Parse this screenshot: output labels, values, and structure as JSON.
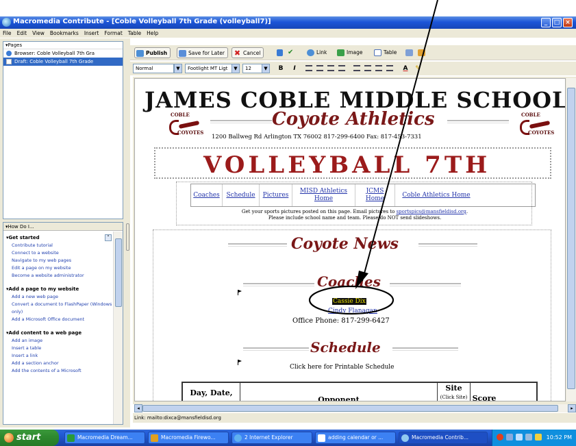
{
  "window": {
    "title": "Macromedia Contribute - [Coble Volleyball 7th Grade (volleyball7)]",
    "buttons": [
      "_",
      "□",
      "×"
    ]
  },
  "menu": [
    "File",
    "Edit",
    "View",
    "Bookmarks",
    "Insert",
    "Format",
    "Table",
    "Help"
  ],
  "pages_panel": {
    "header": "▾Pages",
    "items": [
      {
        "label": "Browser: Coble Volleyball 7th Gra",
        "selected": false
      },
      {
        "label": "Draft: Coble Volleyball 7th Grade",
        "selected": true
      }
    ]
  },
  "howdo": {
    "header": "▾How Do I...",
    "sections": [
      {
        "title": "Get started",
        "links": [
          "Contribute tutorial",
          "Connect to a website",
          "Navigate to my web pages",
          "Edit a page on my website",
          "Become a website administrator"
        ]
      },
      {
        "title": "Add a page to my website",
        "links": [
          "Add a new web page",
          "Convert a document to FlashPaper (Windows only)",
          "Add a Microsoft Office document"
        ]
      },
      {
        "title": "Add content to a web page",
        "links": [
          "Add an image",
          "Insert a table",
          "Insert a link",
          "Add a section anchor",
          "Add the contents of a Microsoft"
        ]
      }
    ]
  },
  "toolbar": {
    "publish": "Publish",
    "save_for_later": "Save for Later",
    "cancel": "Cancel",
    "link": "Link",
    "image": "Image",
    "table": "Table"
  },
  "format_toolbar": {
    "style": "Normal",
    "font": "Footlight MT Ligt",
    "size": "12",
    "bold": "B",
    "italic": "I",
    "text_color": "A"
  },
  "page": {
    "school_title": "JAMES COBLE MIDDLE SCHOOL",
    "logo_top": "COBLE",
    "logo_bottom": "COYOTES",
    "athletics": "Coyote Athletics",
    "address": "1200 Ballweg Rd Arlington TX 76002 817-299-6400 Fax: 817-453-7331",
    "banner": "VOLLEYBALL 7TH",
    "nav": [
      "Coaches",
      "Schedule",
      "Pictures",
      "MISD Athletics Home",
      "JCMS Home",
      "Coble Athletics Home"
    ],
    "note_line1_a": "Get your sports pictures posted on this page. Email pictures to ",
    "note_email": "sportspics@mansfieldisd.org",
    "note_line1_b": ".",
    "note_line2": "Please include school name and team. Please do NOT send slideshows.",
    "news_heading": "Coyote News",
    "coaches_heading": "Coaches",
    "coach1": "Cassie Dix",
    "coach2": "Cindy Flanagan",
    "office_phone": "Office Phone: 817-299-6427",
    "schedule_heading": "Schedule",
    "schedule_link": "Click here for Printable Schedule",
    "table_headers": [
      "Day, Date,",
      "Opponent",
      "Site",
      "Score"
    ],
    "site_sub": "(Click Site)"
  },
  "status_text": "Link: mailto:dixca@mansfieldisd.org",
  "taskbar": {
    "start": "start",
    "tasks": [
      "Macromedia Dream...",
      "Macromedia Firewo...",
      "2 Internet Explorer",
      "adding calendar or ...",
      "Macromedia Contrib..."
    ],
    "clock": "10:52 PM"
  },
  "colors": {
    "title_blue": "#1c55d8",
    "maroon": "#7a1818",
    "link_blue": "#2233aa",
    "annotation": "#000000"
  }
}
